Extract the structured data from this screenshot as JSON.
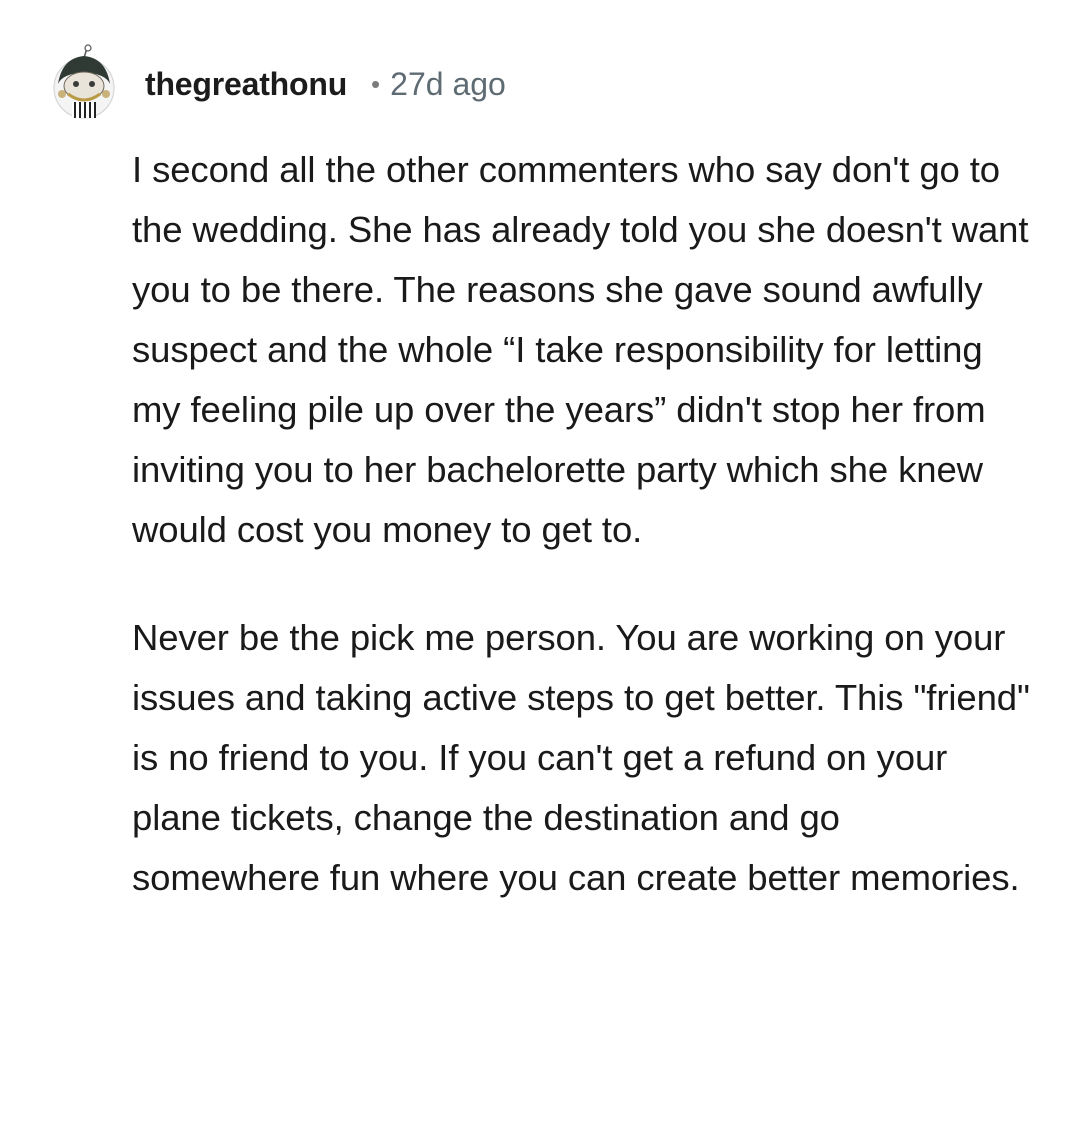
{
  "comment": {
    "avatar_icon": "user-avatar-icon",
    "username": "thegreathonu",
    "separator": "•",
    "timestamp": "27d ago",
    "paragraphs": [
      "I second all the other commenters who say don't go to the wedding. She has already told you she doesn't want you to be there. The reasons she gave sound awfully suspect and the whole “I take responsibility for letting my feeling pile up over the years” didn't stop her from inviting you to her bachelorette party which she knew would cost you money to get to.",
      "Never be the pick me person. You are working on your issues and taking active steps to get better. This \"friend\" is no friend to you. If you can't get a refund on your plane tickets, change the destination and go somewhere fun where you can create better memories."
    ]
  }
}
